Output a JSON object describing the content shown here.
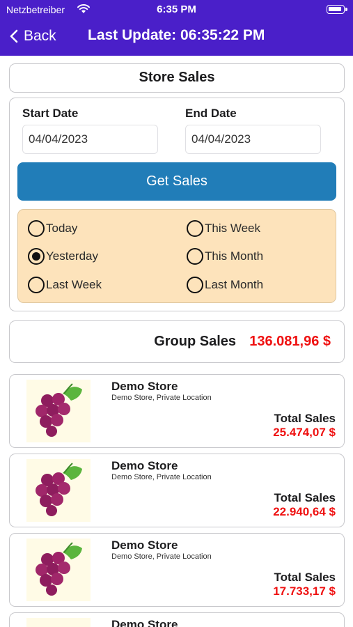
{
  "status_bar": {
    "carrier": "Netzbetreiber",
    "time": "6:35 PM"
  },
  "nav": {
    "back_label": "Back",
    "title": "Last Update: 06:35:22 PM"
  },
  "section_title": "Store Sales",
  "dates": {
    "start_label": "Start Date",
    "start_value": "04/04/2023",
    "end_label": "End Date",
    "end_value": "04/04/2023"
  },
  "get_sales_label": "Get Sales",
  "periods": [
    {
      "label": "Today",
      "selected": false
    },
    {
      "label": "This Week",
      "selected": false
    },
    {
      "label": "Yesterday",
      "selected": true
    },
    {
      "label": "This Month",
      "selected": false
    },
    {
      "label": "Last Week",
      "selected": false
    },
    {
      "label": "Last Month",
      "selected": false
    }
  ],
  "group": {
    "label": "Group Sales",
    "value": "136.081,96 $"
  },
  "stores": [
    {
      "name": "Demo Store",
      "location": "Demo Store, Private Location",
      "total_label": "Total Sales",
      "total": "25.474,07 $",
      "icon": "grapes-icon"
    },
    {
      "name": "Demo Store",
      "location": "Demo Store, Private Location",
      "total_label": "Total Sales",
      "total": "22.940,64 $",
      "icon": "grapes-icon"
    },
    {
      "name": "Demo Store",
      "location": "Demo Store, Private Location",
      "total_label": "Total Sales",
      "total": "17.733,17 $",
      "icon": "grapes-icon"
    },
    {
      "name": "Demo Store",
      "icon": "grapes-icon"
    }
  ],
  "colors": {
    "header": "#4a1fc9",
    "button": "#217db8",
    "radio_panel": "#fde3bb",
    "sales_red": "#ef1111"
  }
}
